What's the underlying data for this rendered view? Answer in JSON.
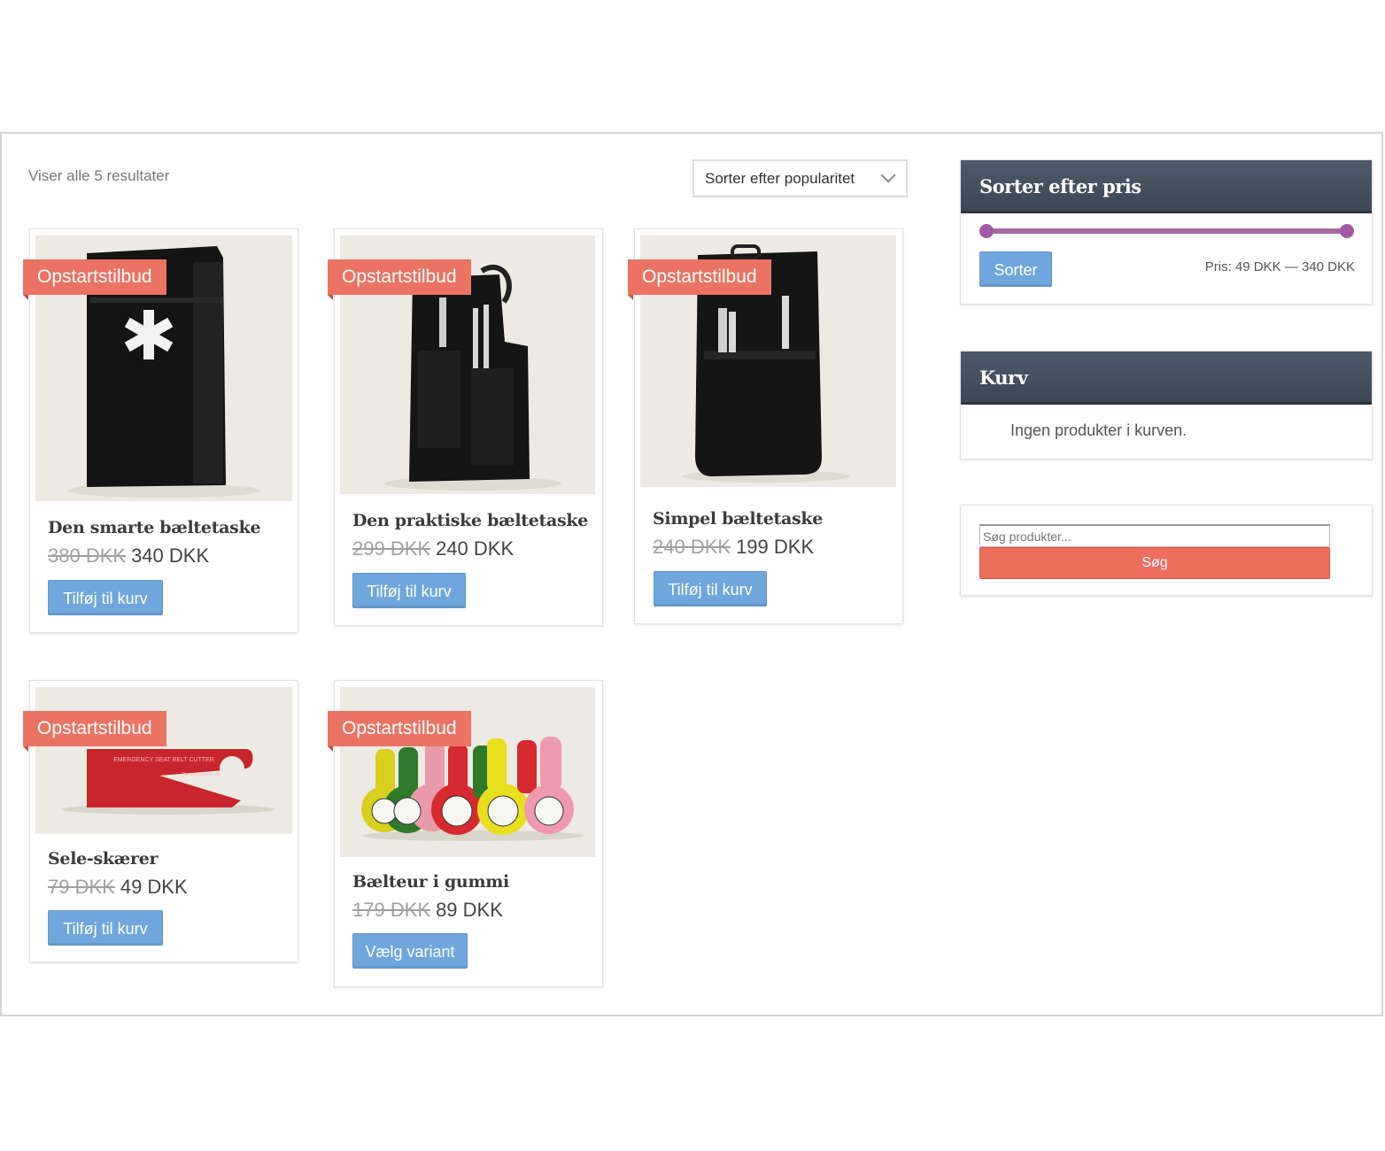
{
  "shop": {
    "result_count": "Viser alle 5 resultater",
    "sort_selected": "Sorter efter popularitet"
  },
  "products": [
    {
      "badge": "Opstartstilbud",
      "title": "Den smarte bæltetaske",
      "old_price": "380 DKK",
      "new_price": "340 DKK",
      "button": "Tilføj til kurv"
    },
    {
      "badge": "Opstartstilbud",
      "title": "Den praktiske bæltetaske",
      "old_price": "299 DKK",
      "new_price": "240 DKK",
      "button": "Tilføj til kurv"
    },
    {
      "badge": "Opstartstilbud",
      "title": "Simpel bæltetaske",
      "old_price": "240 DKK",
      "new_price": "199 DKK",
      "button": "Tilføj til kurv"
    },
    {
      "badge": "Opstartstilbud",
      "title": "Sele-skærer",
      "old_price": "79 DKK",
      "new_price": "49 DKK",
      "button": "Tilføj til kurv"
    },
    {
      "badge": "Opstartstilbud",
      "title": "Bælteur i gummi",
      "old_price": "179 DKK",
      "new_price": "89 DKK",
      "button": "Vælg variant"
    }
  ],
  "price_filter": {
    "heading": "Sorter efter pris",
    "button": "Sorter",
    "range_label": "Pris: 49 DKK — 340 DKK"
  },
  "cart": {
    "heading": "Kurv",
    "empty_text": "Ingen produkter i kurven."
  },
  "search": {
    "placeholder": "Søg produkter...",
    "button": "Søg"
  },
  "product_image_text": {
    "seat_belt_cutter": "EMERGENCY SEAT BELT CUTTER",
    "seat_belt_cutter_tagline": "The tool save a Life"
  }
}
